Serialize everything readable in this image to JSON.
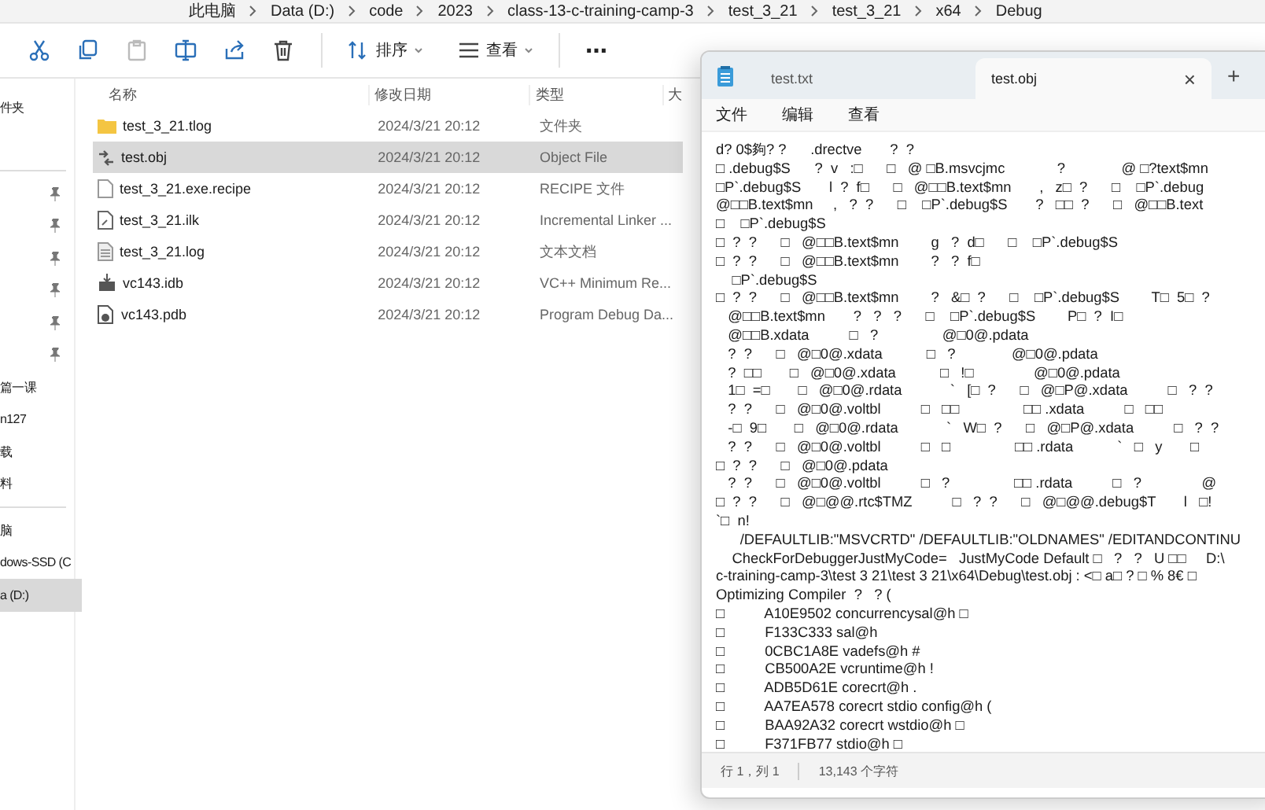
{
  "explorer": {
    "breadcrumb": [
      "此电脑",
      "Data (D:)",
      "code",
      "2023",
      "class-13-c-training-camp-3",
      "test_3_21",
      "test_3_21",
      "x64",
      "Debug"
    ],
    "toolbar": {
      "sort": "排序",
      "view": "查看",
      "more": "⋯"
    },
    "sidebar": {
      "groups": [
        [
          {
            "label": "件夹",
            "pinned": false,
            "selected": false
          }
        ],
        [
          {
            "pinned": true,
            "selected": false
          },
          {
            "pinned": true,
            "selected": false
          },
          {
            "pinned": true,
            "selected": false
          },
          {
            "pinned": true,
            "selected": false
          },
          {
            "pinned": true,
            "selected": false
          },
          {
            "pinned": true,
            "selected": false
          },
          {
            "label": "篇一课",
            "pinned": false,
            "selected": false
          },
          {
            "label": "n127",
            "pinned": false,
            "selected": false
          },
          {
            "label": "载",
            "pinned": false,
            "selected": false
          },
          {
            "label": "料",
            "pinned": false,
            "selected": false
          }
        ],
        [
          {
            "label": "脑",
            "pinned": false,
            "selected": false
          },
          {
            "label": "dows-SSD (C",
            "pinned": false,
            "selected": false
          },
          {
            "label": "a (D:)",
            "pinned": false,
            "selected": true
          }
        ]
      ]
    },
    "columns": [
      "名称",
      "修改日期",
      "类型",
      "大"
    ],
    "files": [
      {
        "name": "test_3_21.tlog",
        "modified": "2024/3/21 20:12",
        "type": "文件夹",
        "kind": "folder",
        "selected": false
      },
      {
        "name": "test.obj",
        "modified": "2024/3/21 20:12",
        "type": "Object File",
        "kind": "object",
        "selected": true
      },
      {
        "name": "test_3_21.exe.recipe",
        "modified": "2024/3/21 20:12",
        "type": "RECIPE 文件",
        "kind": "blank",
        "selected": false
      },
      {
        "name": "test_3_21.ilk",
        "modified": "2024/3/21 20:12",
        "type": "Incremental Linker ...",
        "kind": "linker",
        "selected": false
      },
      {
        "name": "test_3_21.log",
        "modified": "2024/3/21 20:12",
        "type": "文本文档",
        "kind": "text",
        "selected": false
      },
      {
        "name": "vc143.idb",
        "modified": "2024/3/21 20:12",
        "type": "VC++ Minimum Re...",
        "kind": "database",
        "selected": false
      },
      {
        "name": "vc143.pdb",
        "modified": "2024/3/21 20:12",
        "type": "Program Debug Da...",
        "kind": "debug",
        "selected": false
      }
    ]
  },
  "notepad": {
    "tabs": [
      {
        "title": "test.txt",
        "selected": false
      },
      {
        "title": "test.obj",
        "selected": true
      }
    ],
    "close": "×",
    "new_tab": "+",
    "menu": [
      "文件",
      "编辑",
      "查看"
    ],
    "lines": [
      "d? 0$夠? ?      .drectve       ?  ?",
      "□ .debug$S      ?  v   :□      □   @ □B.msvcjmc             ?              @ □?text$mn",
      "□P`.debug$S       l  ?  f□      □   @□□B.text$mn       ,   z□  ?      □    □P`.debug",
      "@□□B.text$mn     ,   ?  ?      □    □P`.debug$S       ?   □□  ?      □   @□□B.text",
      "□    □P`.debug$S",
      "□  ?  ?      □   @□□B.text$mn        g   ?  d□      □    □P`.debug$S",
      "□  ?  ?      □   @□□B.text$mn        ?   ?  f□",
      "    □P`.debug$S",
      "□  ?  ?      □   @□□B.text$mn        ?   &□  ?      □    □P`.debug$S        T□  5□  ?",
      "   @□□B.text$mn       ?   ?   ?      □    □P`.debug$S        P□  ?  I□",
      "   @□□B.xdata          □   ?                @□0@.pdata",
      "   ?  ?      □   @□0@.xdata           □   ?              @□0@.pdata",
      "   ?  □□       □   @□0@.xdata           □   !□               @□0@.pdata",
      "   1□  =□       □   @□0@.rdata            `   [□  ?      □   @□P@.xdata          □   ?  ?",
      "   ?  ?      □   @□0@.voltbl          □   □□                □□ .xdata          □   □□",
      "   -□  9□       □   @□0@.rdata            `   W□  ?      □   @□P@.xdata          □   ?  ?",
      "   ?  ?      □   @□0@.voltbl          □   □                □□ .rdata           `   □   y       □",
      "□  ?  ?      □   @□0@.pdata",
      "   ?  ?      □   @□0@.voltbl          □   ?                □□ .rdata          □   ?               @",
      "□  ?  ?      □   @□@@.rtc$TMZ          □   ?  ?      □   @□@@.debug$T       l   □!",
      "`□  n!",
      "      /DEFAULTLIB:\"MSVCRTD\" /DEFAULTLIB:\"OLDNAMES\" /EDITANDCONTINU",
      "    CheckForDebuggerJustMyCode=   JustMyCode Default □   ?   ?   U □□     D:\\",
      "c-training-camp-3\\test 3 21\\test 3 21\\x64\\Debug\\test.obj : <□ a□ ? □ % 8€ □",
      "Optimizing Compiler  ?   ? (",
      "□          A10E9502 concurrencysal@h □",
      "□          F133C333 sal@h",
      "□          0CBC1A8E vadefs@h #",
      "□          CB500A2E vcruntime@h !",
      "□          ADB5D61E corecrt@h .",
      "□          AA7EA578 corecrt stdio config@h (",
      "□          BAA92A32 corecrt wstdio@h □",
      "□          F371FB77 stdio@h □"
    ],
    "status_bar": {
      "position": "行 1，列 1",
      "characters": "13,143 个字符"
    }
  }
}
